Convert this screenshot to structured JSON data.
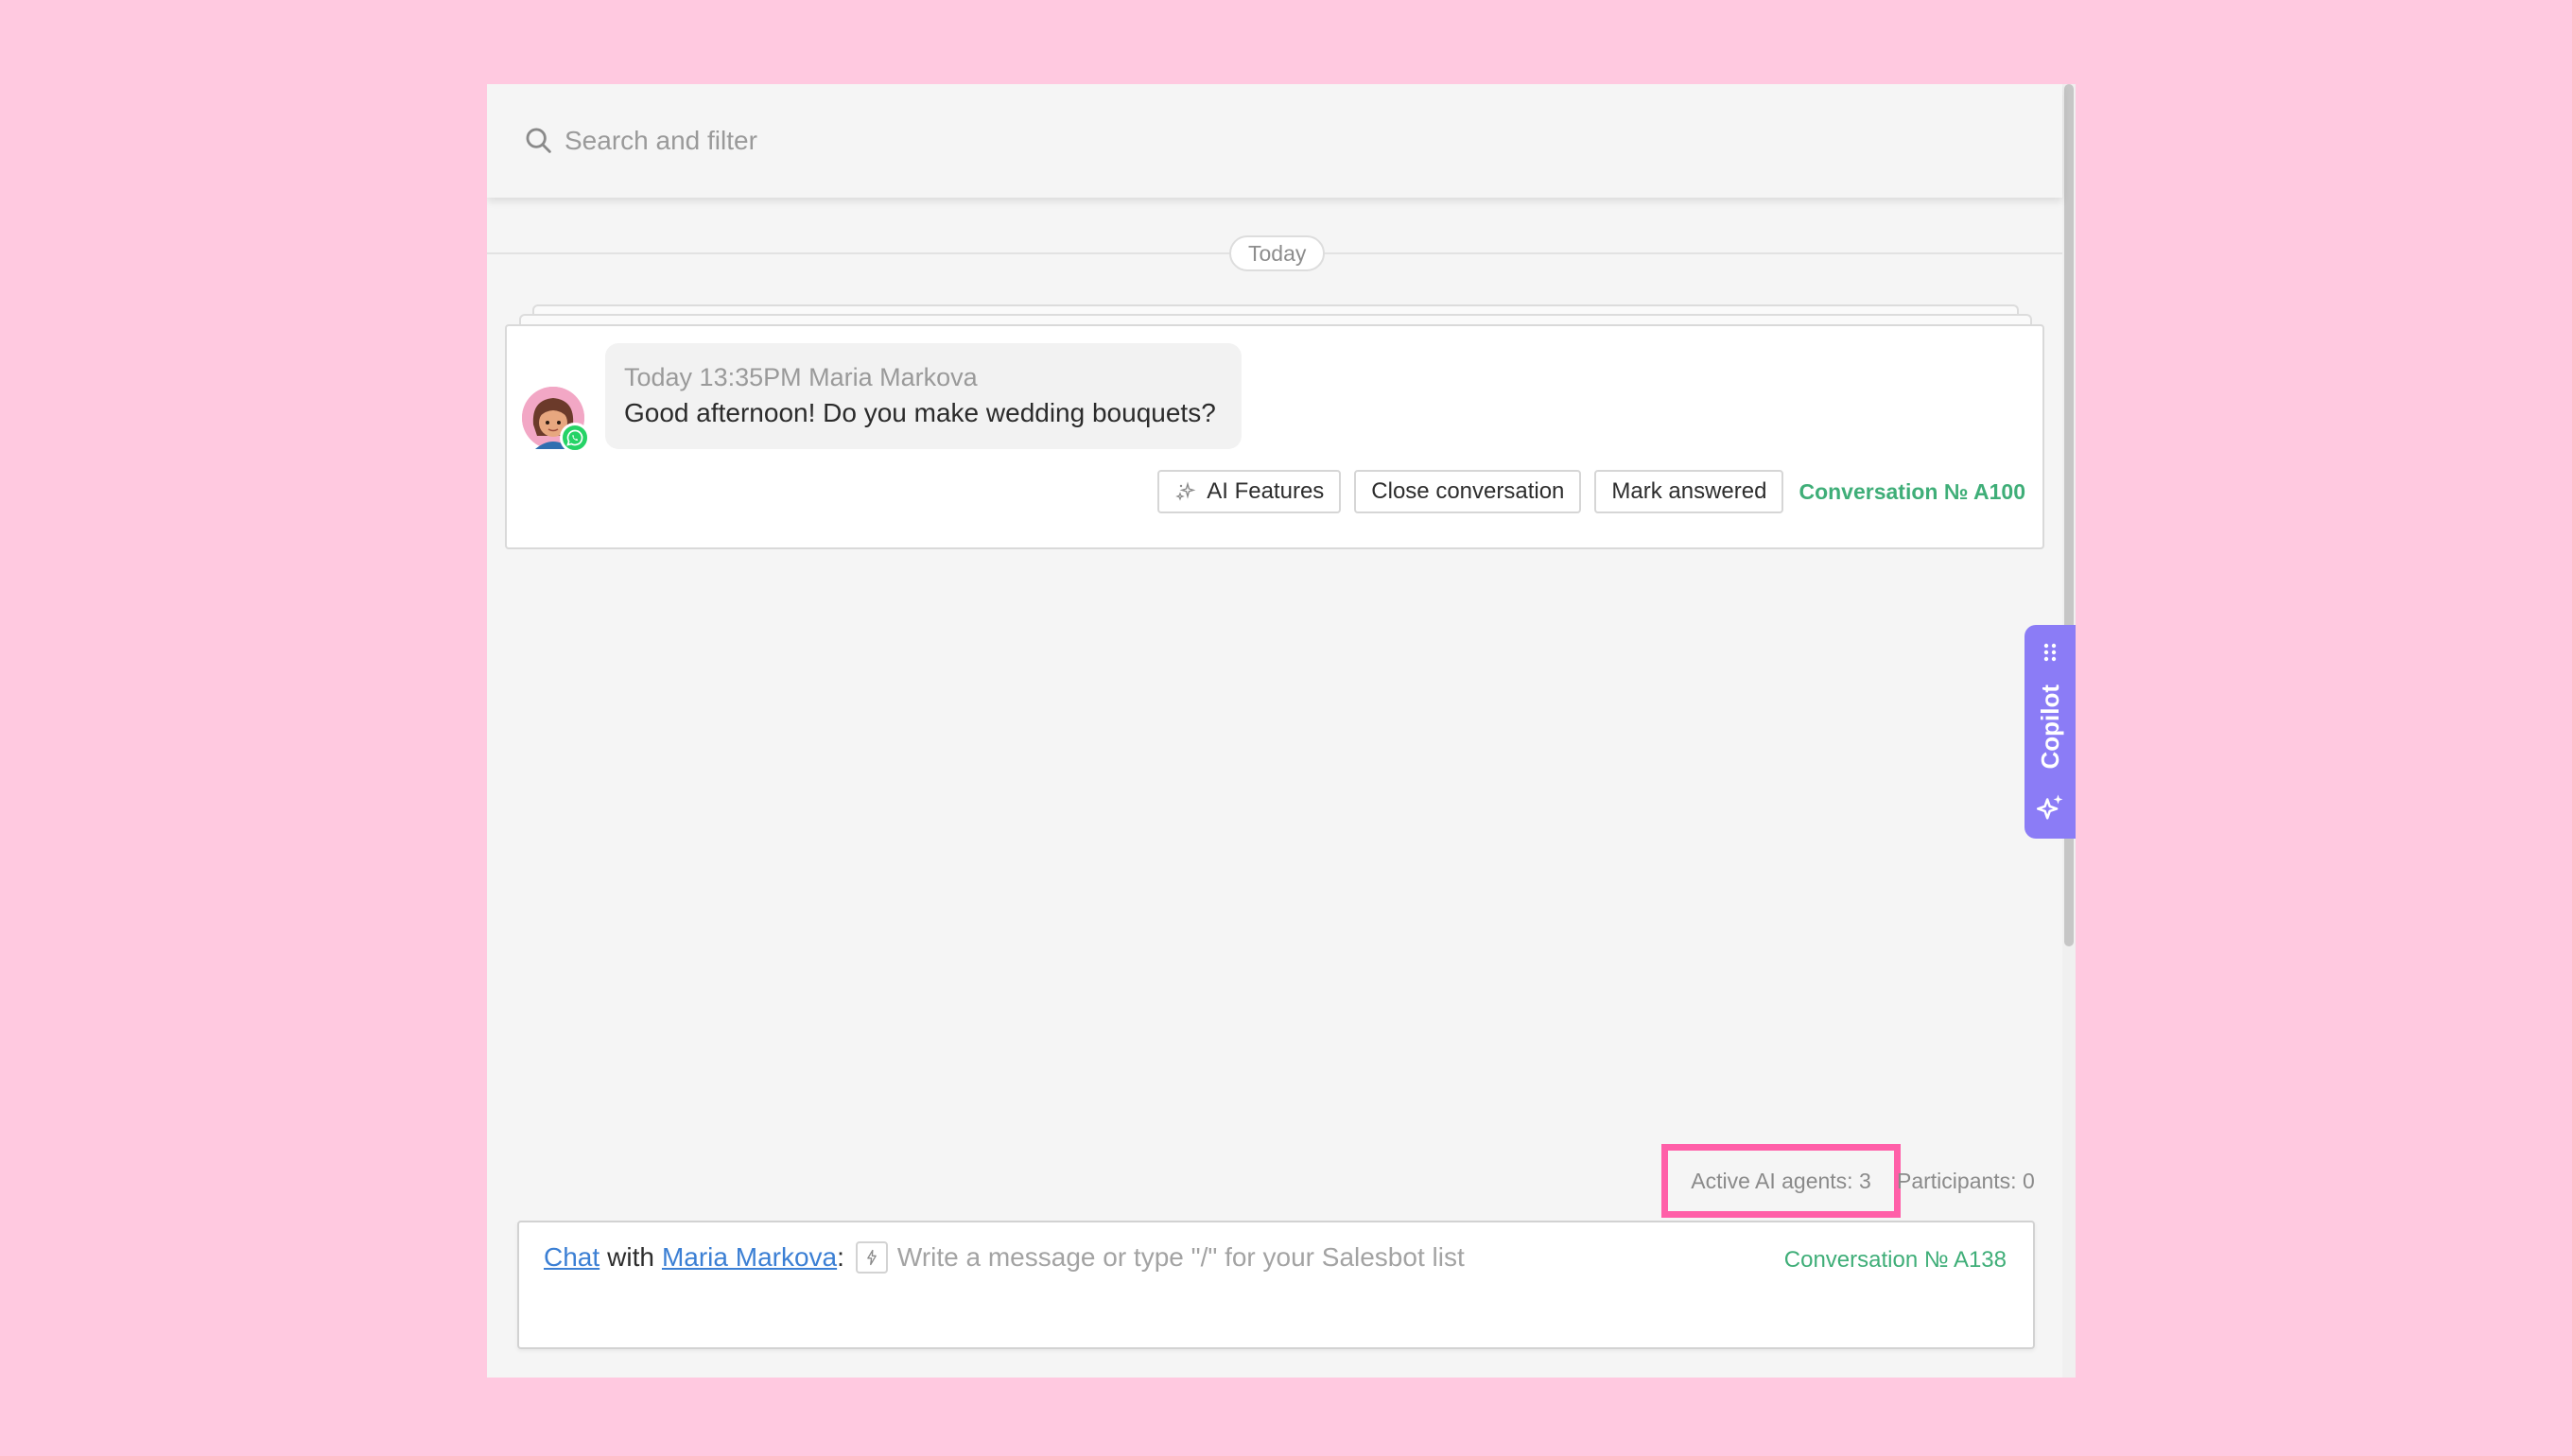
{
  "search": {
    "placeholder": "Search and filter"
  },
  "feed": {
    "date_label": "Today",
    "message": {
      "meta": "Today 13:35PM Maria Markova",
      "text": "Good afternoon! Do you make wedding bouquets?"
    },
    "actions": {
      "ai_features": "AI Features",
      "close_conversation": "Close conversation",
      "mark_answered": "Mark answered",
      "conversation_link": "Conversation № A100"
    }
  },
  "copilot": {
    "label": "Copilot"
  },
  "status": {
    "active_agents": "Active AI agents: 3",
    "participants": "Participants: 0"
  },
  "composer": {
    "chat_link": "Chat",
    "with": "with",
    "contact_link": "Maria Markova",
    "colon": ":",
    "placeholder": "Write a message or type \"/\" for your Salesbot list",
    "conversation_number": "Conversation № A138"
  },
  "colors": {
    "background": "#ffc9e0",
    "accent_green": "#3fae78",
    "link_blue": "#3b7fd4",
    "copilot_purple": "#8b7cf6",
    "highlight_pink": "#ff5fa8",
    "whatsapp_green": "#25d366"
  },
  "icons": {
    "search": "search-icon",
    "whatsapp": "whatsapp-icon",
    "ai": "sparkles-icon",
    "grip": "drag-handle-icon",
    "bolt": "lightning-icon"
  }
}
